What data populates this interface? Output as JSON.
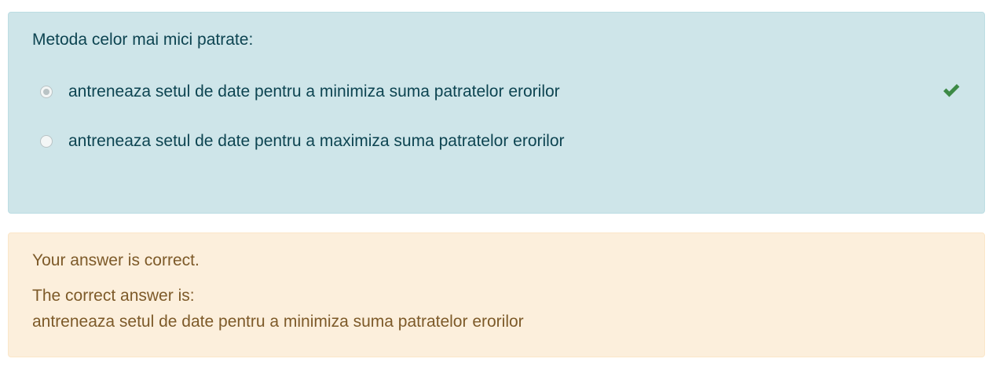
{
  "question": {
    "text": "Metoda celor mai mici patrate:",
    "options": [
      {
        "label": "antreneaza setul de date pentru a minimiza suma patratelor erorilor",
        "selected": true
      },
      {
        "label": "antreneaza setul de date pentru a maximiza suma patratelor erorilor",
        "selected": false
      }
    ],
    "status_icon": "check-icon",
    "status_color": "#3d8a46"
  },
  "feedback": {
    "result": "Your answer is correct.",
    "correct_heading": "The correct answer is:",
    "correct_answer": "antreneaza setul de date pentru a minimiza suma patratelor erorilor"
  },
  "colors": {
    "question_bg": "#cee5e9",
    "question_text": "#0d4451",
    "feedback_bg": "#fcefdc",
    "feedback_text": "#7d5a29"
  }
}
